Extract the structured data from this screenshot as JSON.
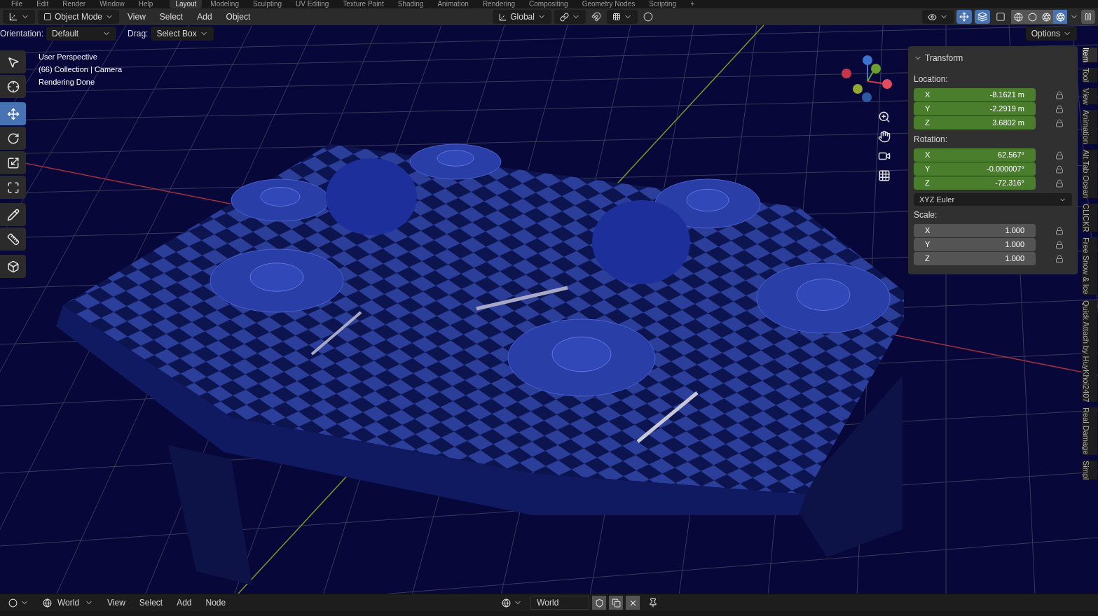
{
  "menu": [
    "File",
    "Edit",
    "Render",
    "Window",
    "Help"
  ],
  "workspace_tabs": [
    {
      "label": "Layout",
      "selected": true
    },
    {
      "label": "Modeling",
      "selected": false
    },
    {
      "label": "Sculpting",
      "selected": false
    },
    {
      "label": "UV Editing",
      "selected": false
    },
    {
      "label": "Texture Paint",
      "selected": false
    },
    {
      "label": "Shading",
      "selected": false
    },
    {
      "label": "Animation",
      "selected": false
    },
    {
      "label": "Rendering",
      "selected": false
    },
    {
      "label": "Compositing",
      "selected": false
    },
    {
      "label": "Geometry Nodes",
      "selected": false
    },
    {
      "label": "Scripting",
      "selected": false
    },
    {
      "label": "+",
      "selected": false
    }
  ],
  "header": {
    "mode": "Object Mode",
    "menus": [
      "View",
      "Select",
      "Add",
      "Object"
    ],
    "transform_orientation": "Global",
    "snap": {
      "on": false
    },
    "proportional_edit": {
      "on": false
    },
    "show_gizmo": {
      "on": true
    },
    "show_overlays": {
      "on": true
    },
    "xray": {
      "on": false
    },
    "shading_modes": [
      {
        "kind": "wireframe",
        "selected": false
      },
      {
        "kind": "solid",
        "selected": false
      },
      {
        "kind": "material",
        "selected": false
      },
      {
        "kind": "rendered",
        "selected": true
      }
    ]
  },
  "tool_settings": {
    "orientation_label": "Orientation:",
    "orientation": "Default",
    "drag_label": "Drag:",
    "drag": "Select Box",
    "options": "Options"
  },
  "toolbar": [
    {
      "kind": "select",
      "selected": false
    },
    {
      "kind": "cursor",
      "selected": false
    },
    {
      "kind": "move",
      "selected": true
    },
    {
      "kind": "rotate",
      "selected": false
    },
    {
      "kind": "scale",
      "selected": false
    },
    {
      "kind": "transform",
      "selected": false
    },
    {
      "kind": "annotate",
      "selected": false
    },
    {
      "kind": "measure",
      "selected": false
    },
    {
      "kind": "add-cube",
      "selected": false
    }
  ],
  "viewport_info": [
    "User Perspective",
    "(66) Collection | Camera",
    "Rendering Done"
  ],
  "transform": {
    "title": "Transform",
    "sections": [
      {
        "label": "Location:",
        "rows": [
          {
            "axis": "X",
            "value": "-8.1621 m",
            "keyed": true
          },
          {
            "axis": "Y",
            "value": "-2.2919 m",
            "keyed": true
          },
          {
            "axis": "Z",
            "value": "3.6802 m",
            "keyed": true
          }
        ]
      },
      {
        "label": "Rotation:",
        "rows": [
          {
            "axis": "X",
            "value": "62.567°",
            "keyed": true
          },
          {
            "axis": "Y",
            "value": "-0.000007°",
            "keyed": true
          },
          {
            "axis": "Z",
            "value": "-72.316°",
            "keyed": true
          }
        ],
        "mode": "XYZ Euler"
      },
      {
        "label": "Scale:",
        "rows": [
          {
            "axis": "X",
            "value": "1.000",
            "keyed": false
          },
          {
            "axis": "Y",
            "value": "1.000",
            "keyed": false
          },
          {
            "axis": "Z",
            "value": "1.000",
            "keyed": false
          }
        ]
      }
    ]
  },
  "side_tabs": [
    {
      "label": "Item",
      "selected": true
    },
    {
      "label": "Tool",
      "selected": false
    },
    {
      "label": "View",
      "selected": false
    },
    {
      "label": "Animation",
      "selected": false
    },
    {
      "label": "Alt Tab Ocean",
      "selected": false
    },
    {
      "label": "CLICKR",
      "selected": false
    },
    {
      "label": "Free Snow & Ice",
      "selected": false
    },
    {
      "label": "Quick Attach by HuyKhoi2407",
      "selected": false
    },
    {
      "label": "Real Damage",
      "selected": false
    },
    {
      "label": "Simpl",
      "selected": false
    }
  ],
  "bottom_bar": {
    "world": "World",
    "menus": [
      "View",
      "Select",
      "Add",
      "Node"
    ],
    "datablock": "World"
  }
}
